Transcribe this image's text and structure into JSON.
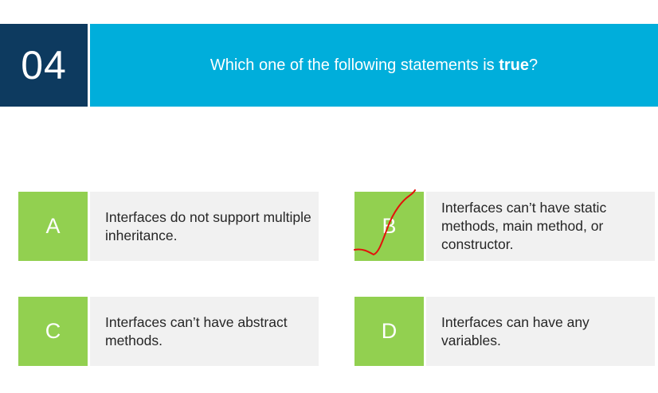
{
  "question": {
    "number": "04",
    "text_prefix": "Which one of the following statements is ",
    "text_emphasis": "true",
    "text_suffix": "?"
  },
  "options": [
    {
      "letter": "A",
      "text": "Interfaces do not support multiple inheritance."
    },
    {
      "letter": "B",
      "text": "Interfaces can’t have static methods, main method, or constructor."
    },
    {
      "letter": "C",
      "text": "Interfaces can’t have abstract methods."
    },
    {
      "letter": "D",
      "text": "Interfaces can have any variables."
    }
  ],
  "annotation": {
    "color": "#e3120b"
  }
}
